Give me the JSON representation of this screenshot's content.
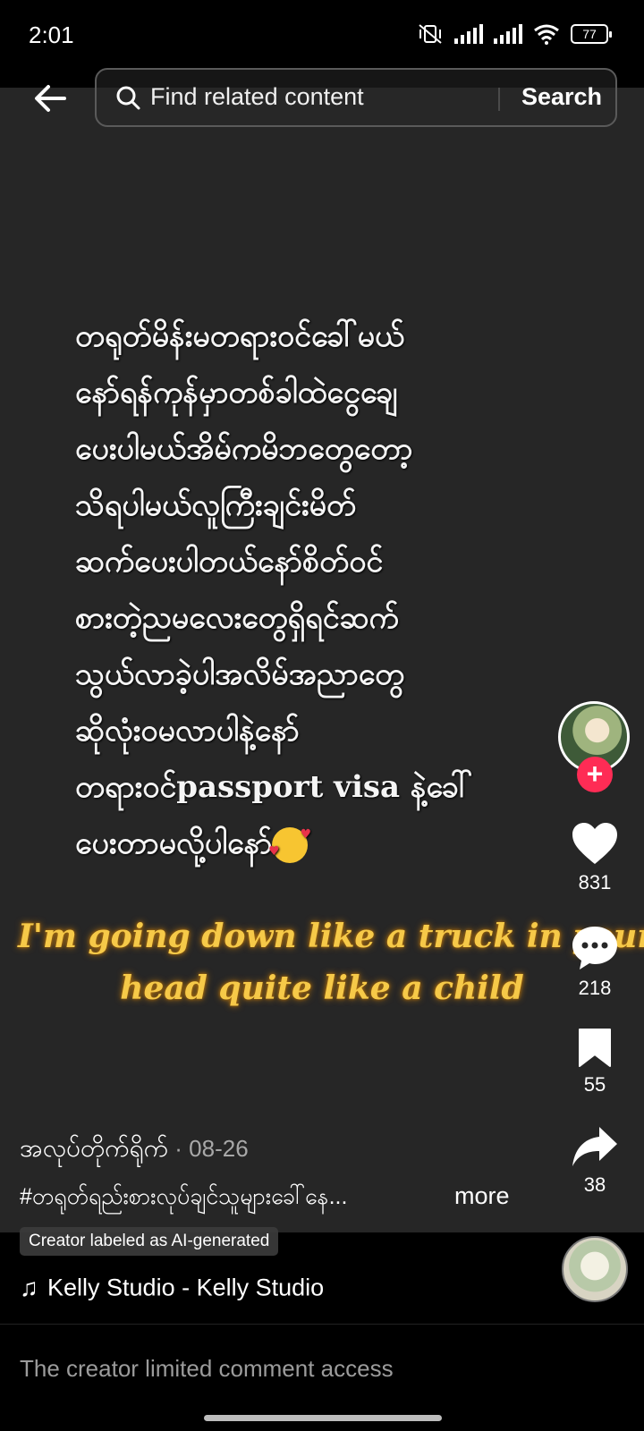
{
  "status_bar": {
    "time": "2:01",
    "battery": "77",
    "icons": [
      "muted-vibrate-icon",
      "signal-icon",
      "signal-icon",
      "wifi-icon",
      "battery-icon"
    ]
  },
  "header": {
    "back_icon": "back-arrow-icon",
    "search_placeholder": "Find related content",
    "search_button": "Search"
  },
  "video": {
    "overlay_lines": [
      "တရုတ်မိန်းမတရားဝင်ခေါ်မယ်",
      "နော်ရန်ကုန်မှာတစ်ခါထဲငွေချေ",
      "ပေးပါမယ်အိမ်ကမိဘတွေတော့",
      "သိရပါမယ်လူကြီးချင်းမိတ်",
      "ဆက်ပေးပါတယ်နော်စိတ်ဝင်",
      "စားတဲ့ညမလေးတွေရှိရင်ဆက်",
      "သွယ်လာခဲ့ပါအလိမ်အညာတွေ",
      "ဆိုလုံးဝမလာပါနဲ့နော်",
      "တရားဝင်passport visa နဲ့ခေါ်",
      "ပေးတာမလို့ပါနော်"
    ],
    "overlay_emoji": "smiling-face-with-hearts",
    "lyrics": [
      "I'm going down like a truck in your",
      "head quite like a child"
    ]
  },
  "actions": {
    "likes": "831",
    "comments": "218",
    "bookmarks": "55",
    "shares": "38",
    "follow_symbol": "+"
  },
  "post": {
    "username": "အလုပ်တိုက်ရိုက်",
    "date": " · 08-26",
    "caption": "#တရုတ်ရည်းစားလုပ်ချင်သူများခေါ်နေ...",
    "more": "more",
    "ai_label": "Creator labeled as AI-generated",
    "music": "Kelly Studio - Kelly Studio"
  },
  "footer": {
    "comment_notice": "The creator limited comment access"
  },
  "colors": {
    "accent": "#fe2c55",
    "lyrics": "#f6c948",
    "video_bg": "#262626"
  }
}
